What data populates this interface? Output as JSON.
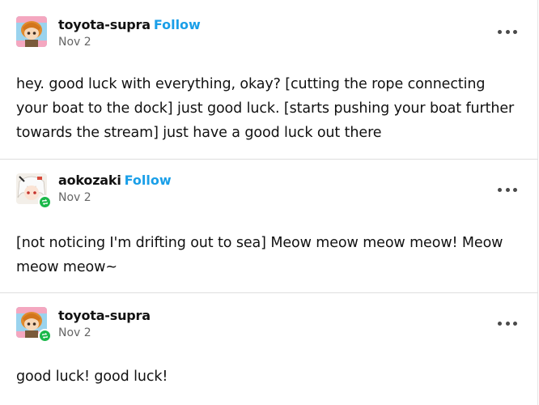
{
  "posts": [
    {
      "username": "toyota-supra",
      "follow_label": "Follow",
      "date": "Nov 2",
      "avatar_icon": "figure-avatar-orange-hair",
      "reblogged": false,
      "body": "hey. good luck with everything, okay? [cutting the rope connecting your boat to the dock]  just good luck. [starts pushing your boat further towards the stream] just have a good luck out there"
    },
    {
      "username": "aokozaki",
      "follow_label": "Follow",
      "date": "Nov 2",
      "avatar_icon": "anime-avatar-white-hair",
      "reblogged": true,
      "body": "[not noticing I'm drifting out to sea] Meow meow meow meow! Meow meow meow~"
    },
    {
      "username": "toyota-supra",
      "follow_label": "",
      "date": "Nov 2",
      "avatar_icon": "figure-avatar-orange-hair",
      "reblogged": true,
      "body": "good luck! good luck!"
    }
  ],
  "colors": {
    "follow": "#1a9fe8",
    "reblog_badge": "#1bb84a",
    "divider": "#dedede",
    "text": "#111111",
    "muted": "#666666"
  }
}
